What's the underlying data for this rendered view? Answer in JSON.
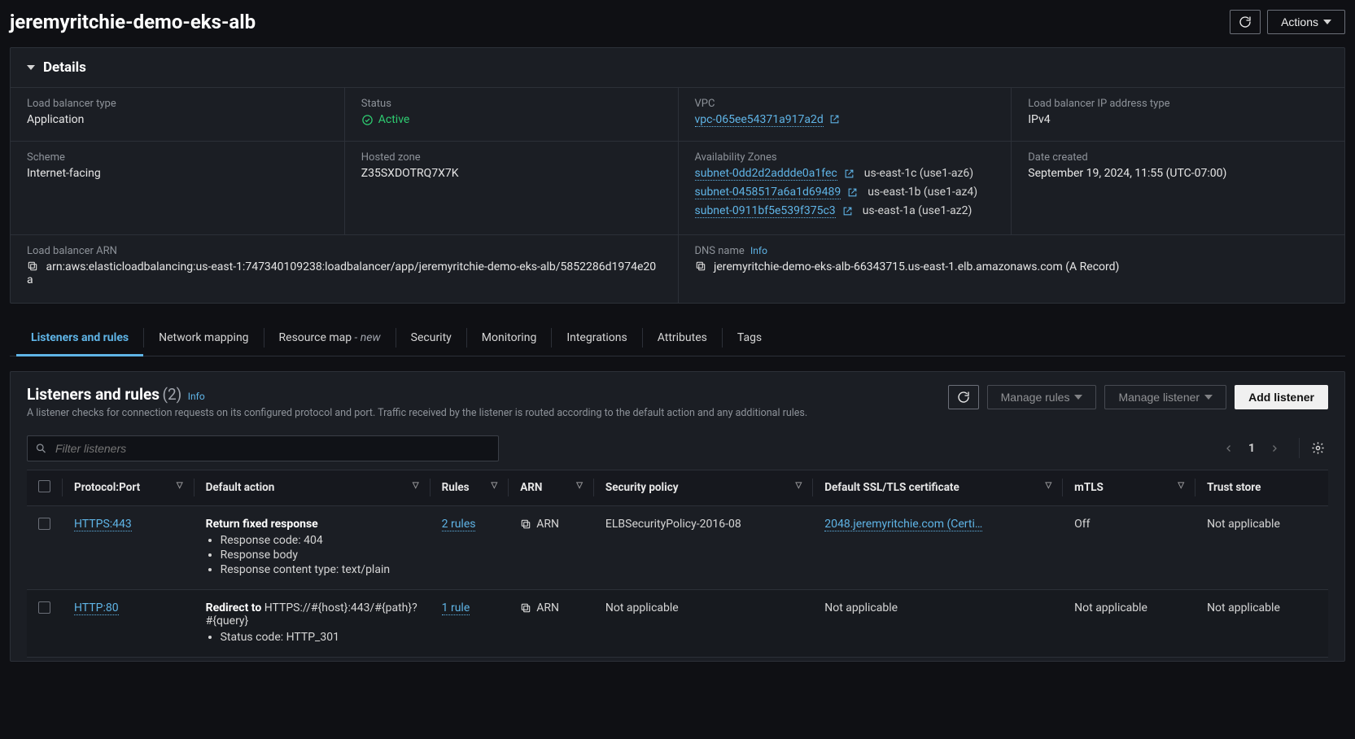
{
  "header": {
    "title": "jeremyritchie-demo-eks-alb",
    "actions_label": "Actions"
  },
  "details": {
    "panel_title": "Details",
    "lb_type_label": "Load balancer type",
    "lb_type": "Application",
    "status_label": "Status",
    "status": "Active",
    "vpc_label": "VPC",
    "vpc_link": "vpc-065ee54371a917a2d",
    "ip_type_label": "Load balancer IP address type",
    "ip_type": "IPv4",
    "scheme_label": "Scheme",
    "scheme": "Internet-facing",
    "hosted_zone_label": "Hosted zone",
    "hosted_zone": "Z35SXDOTRQ7X7K",
    "az_label": "Availability Zones",
    "azs": [
      {
        "subnet": "subnet-0dd2d2addde0a1fec",
        "zone": "us-east-1c (use1-az6)"
      },
      {
        "subnet": "subnet-0458517a6a1d69489",
        "zone": "us-east-1b (use1-az4)"
      },
      {
        "subnet": "subnet-0911bf5e539f375c3",
        "zone": "us-east-1a (use1-az2)"
      }
    ],
    "date_label": "Date created",
    "date": "September 19, 2024, 11:55 (UTC-07:00)",
    "arn_label": "Load balancer ARN",
    "arn": "arn:aws:elasticloadbalancing:us-east-1:747340109238:loadbalancer/app/jeremyritchie-demo-eks-alb/5852286d1974e20a",
    "dns_label": "DNS name",
    "dns_info": "Info",
    "dns": "jeremyritchie-demo-eks-alb-66343715.us-east-1.elb.amazonaws.com (A Record)"
  },
  "tabs": [
    "Listeners and rules",
    "Network mapping",
    "Resource map",
    "Security",
    "Monitoring",
    "Integrations",
    "Attributes",
    "Tags"
  ],
  "tab_new_suffix": " - new",
  "listeners": {
    "title": "Listeners and rules",
    "count": "(2)",
    "info": "Info",
    "desc": "A listener checks for connection requests on its configured protocol and port. Traffic received by the listener is routed according to the default action and any additional rules.",
    "manage_rules": "Manage rules",
    "manage_listener": "Manage listener",
    "add_listener": "Add listener",
    "filter_placeholder": "Filter listeners",
    "page": "1",
    "columns": [
      "Protocol:Port",
      "Default action",
      "Rules",
      "ARN",
      "Security policy",
      "Default SSL/TLS certificate",
      "mTLS",
      "Trust store"
    ],
    "rows": [
      {
        "protocol": "HTTPS:443",
        "action_title": "Return fixed response",
        "action_lines": [
          "Response code: 404",
          "Response body",
          "Response content type: text/plain"
        ],
        "rules": "2 rules",
        "arn": "ARN",
        "security": "ELBSecurityPolicy-2016-08",
        "cert": "2048.jeremyritchie.com (Certi…",
        "mtls": "Off",
        "trust": "Not applicable"
      },
      {
        "protocol": "HTTP:80",
        "action_title_prefix": "Redirect to ",
        "action_title_value": "HTTPS://#{host}:443/#{path}?#{query}",
        "action_lines": [
          "Status code: HTTP_301"
        ],
        "rules": "1 rule",
        "arn": "ARN",
        "security": "Not applicable",
        "cert": "Not applicable",
        "mtls": "Not applicable",
        "trust": "Not applicable"
      }
    ]
  }
}
